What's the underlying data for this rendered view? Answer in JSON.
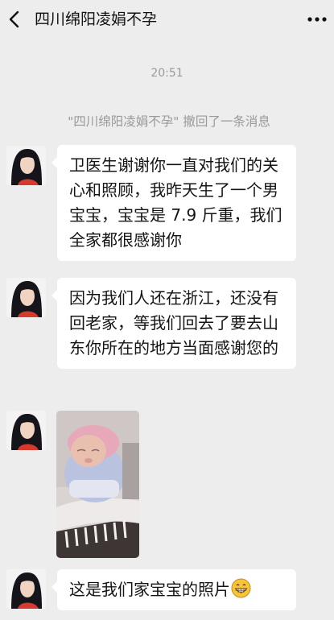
{
  "header": {
    "back_icon": "chevron-left-icon",
    "title": "四川绵阳凌娟不孕",
    "more_icon": "more-dots-icon"
  },
  "chat": {
    "timestamp": "20:51",
    "recall_notice": "\"四川绵阳凌娟不孕\" 撤回了一条消息",
    "messages": [
      {
        "type": "text",
        "text": "卫医生谢谢你一直对我们的关心和照顾，我昨天生了一个男宝宝，宝宝是 7.9 斤重，我们全家都很感谢你"
      },
      {
        "type": "text",
        "text": "因为我们人还在浙江，还没有回老家，等我们回去了要去山东你所在的地方当面感谢您的"
      },
      {
        "type": "image",
        "image": "baby-photo"
      },
      {
        "type": "text",
        "text": "这是我们家宝宝的照片",
        "emoji": "grinning-face-icon"
      }
    ]
  },
  "colors": {
    "background": "#ededed",
    "bubble": "#ffffff",
    "system_text": "#9a9a9a"
  }
}
